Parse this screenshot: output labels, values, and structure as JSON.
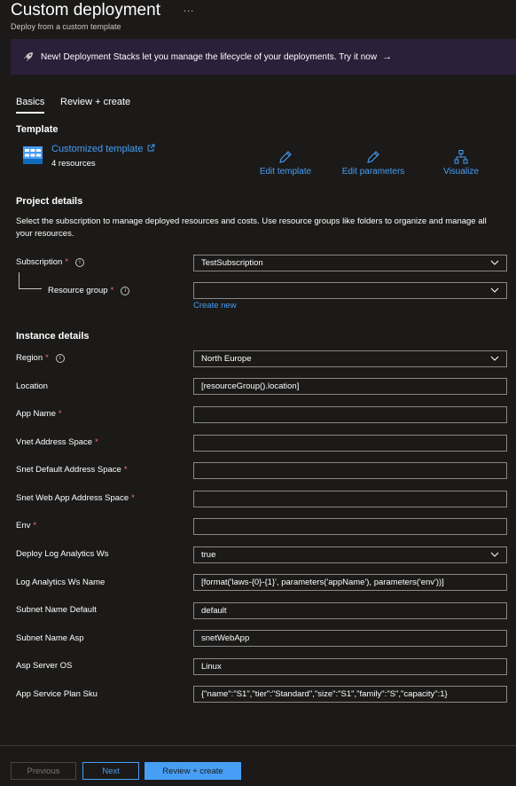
{
  "header": {
    "title": "Custom deployment",
    "more_label": "...",
    "subtitle": "Deploy from a custom template"
  },
  "banner": {
    "text": "New! Deployment Stacks let you manage the lifecycle of your deployments. Try it now",
    "icon": "rocket-icon",
    "arrow": "→"
  },
  "tabs": [
    {
      "label": "Basics",
      "active": true
    },
    {
      "label": "Review + create",
      "active": false
    }
  ],
  "template": {
    "heading": "Template",
    "link_label": "Customized template",
    "resource_count": "4 resources",
    "actions": [
      {
        "label": "Edit template",
        "icon": "pencil-icon"
      },
      {
        "label": "Edit parameters",
        "icon": "pencil-icon"
      },
      {
        "label": "Visualize",
        "icon": "hierarchy-icon"
      }
    ]
  },
  "project": {
    "heading": "Project details",
    "description": "Select the subscription to manage deployed resources and costs. Use resource groups like folders to organize and manage all your resources.",
    "subscription_label": "Subscription",
    "subscription_value": "TestSubscription",
    "resource_group_label": "Resource group",
    "resource_group_value": "",
    "create_new_label": "Create new"
  },
  "instance": {
    "heading": "Instance details",
    "region_label": "Region",
    "region_value": "North Europe",
    "fields": [
      {
        "label": "Location",
        "value": "[resourceGroup().location]",
        "required": false,
        "dropdown": false
      },
      {
        "label": "App Name",
        "value": "",
        "required": true,
        "dropdown": false
      },
      {
        "label": "Vnet Address Space",
        "value": "",
        "required": true,
        "dropdown": false
      },
      {
        "label": "Snet Default Address Space",
        "value": "",
        "required": true,
        "dropdown": false
      },
      {
        "label": "Snet Web App Address Space",
        "value": "",
        "required": true,
        "dropdown": false
      },
      {
        "label": "Env",
        "value": "",
        "required": true,
        "dropdown": false
      },
      {
        "label": "Deploy Log Analytics Ws",
        "value": "true",
        "required": false,
        "dropdown": true
      },
      {
        "label": "Log Analytics Ws Name",
        "value": "[format('laws-{0}-{1}', parameters('appName'), parameters('env'))]",
        "required": false,
        "dropdown": false
      },
      {
        "label": "Subnet Name Default",
        "value": "default",
        "required": false,
        "dropdown": false
      },
      {
        "label": "Subnet Name Asp",
        "value": "snetWebApp",
        "required": false,
        "dropdown": false
      },
      {
        "label": "Asp Server OS",
        "value": "Linux",
        "required": false,
        "dropdown": false
      },
      {
        "label": "App Service Plan Sku",
        "value": "{\"name\":\"S1\",\"tier\":\"Standard\",\"size\":\"S1\",\"family\":\"S\",\"capacity\":1}",
        "required": false,
        "dropdown": false
      }
    ]
  },
  "footer": {
    "previous_label": "Previous",
    "next_label": "Next",
    "review_label": "Review + create"
  },
  "colors": {
    "background": "#1b1a19",
    "accent": "#479ef5",
    "required": "#f1707b",
    "banner": "#2c1f3a"
  }
}
